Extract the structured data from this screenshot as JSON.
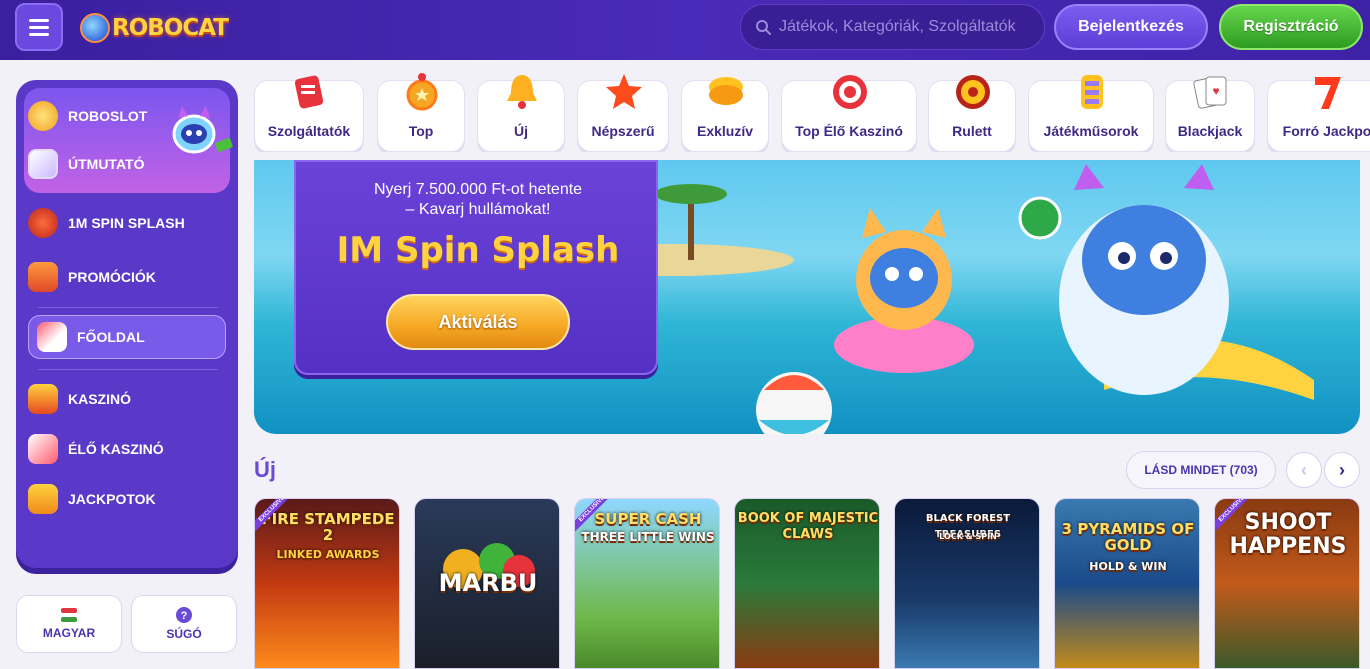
{
  "header": {
    "logo_text": "ROBOCAT",
    "search_placeholder": "Játékok, Kategóriák, Szolgáltatók",
    "login_label": "Bejelentkezés",
    "register_label": "Regisztráció"
  },
  "sidebar": {
    "top_items": [
      {
        "label": "ROBOSLOT",
        "icon": "coin-stack-icon"
      },
      {
        "label": "ÚTMUTATÓ",
        "icon": "map-guide-icon"
      }
    ],
    "items": [
      {
        "label": "1M SPIN SPLASH",
        "icon": "splash-fruit-icon"
      },
      {
        "label": "PROMÓCIÓK",
        "icon": "gift-icon"
      },
      {
        "label": "FŐOLDAL",
        "icon": "home-icon"
      },
      {
        "label": "KASZINÓ",
        "icon": "slot-777-icon"
      },
      {
        "label": "ÉLŐ KASZINÓ",
        "icon": "cards-dice-icon"
      },
      {
        "label": "JACKPOTOK",
        "icon": "lucky-seven-icon"
      }
    ],
    "active": "FŐOLDAL"
  },
  "footer_boxes": {
    "language": "MAGYAR",
    "help": "SÚGÓ"
  },
  "categories": [
    {
      "label": "Szolgáltatók",
      "icon": "providers-icon"
    },
    {
      "label": "Top",
      "icon": "medal-icon"
    },
    {
      "label": "Új",
      "icon": "bell-icon"
    },
    {
      "label": "Népszerű",
      "icon": "star-icon"
    },
    {
      "label": "Exkluzív",
      "icon": "gold-bar-icon"
    },
    {
      "label": "Top Élő Kaszinó",
      "icon": "roulette-chip-icon"
    },
    {
      "label": "Rulett",
      "icon": "roulette-wheel-icon"
    },
    {
      "label": "Játékműsorok",
      "icon": "game-show-icon"
    },
    {
      "label": "Blackjack",
      "icon": "playing-cards-icon"
    },
    {
      "label": "Forró Jackpo",
      "icon": "hot-seven-icon"
    }
  ],
  "banner": {
    "subtitle_line1": "Nyerj 7.500.000 Ft-ot hetente",
    "subtitle_line2": "– Kavarj hullámokat!",
    "title": "IM Spin Splash",
    "button_label": "Aktiválás"
  },
  "new_section": {
    "title": "Új",
    "see_all_label": "LÁSD MINDET (703)",
    "prev_icon": "chevron-left-icon",
    "next_icon": "chevron-right-icon"
  },
  "games": [
    {
      "title": "FIRE STAMPEDE 2",
      "subtitle": "LINKED AWARDS",
      "exclusive": true
    },
    {
      "title": "MARBU",
      "subtitle": "",
      "exclusive": false
    },
    {
      "title": "SUPER CASH",
      "subtitle": "THREE LITTLE WINS",
      "exclusive": true
    },
    {
      "title": "BOOK OF MAJESTIC CLAWS",
      "subtitle": "",
      "exclusive": false
    },
    {
      "title": "BLACK FOREST TREASURES",
      "subtitle": "LOCK & SPIN",
      "exclusive": false
    },
    {
      "title": "3 PYRAMIDS OF GOLD",
      "subtitle": "HOLD & WIN",
      "exclusive": false
    },
    {
      "title": "SHOOT HAPPENS",
      "subtitle": "",
      "exclusive": true
    }
  ],
  "exclusive_badge": "EXCLUSIVE",
  "colors": {
    "header_bg": "#3a1f9e",
    "accent_purple": "#5a38c8",
    "register_green": "#3cb12e",
    "promo_yellow": "#ffd23f"
  }
}
